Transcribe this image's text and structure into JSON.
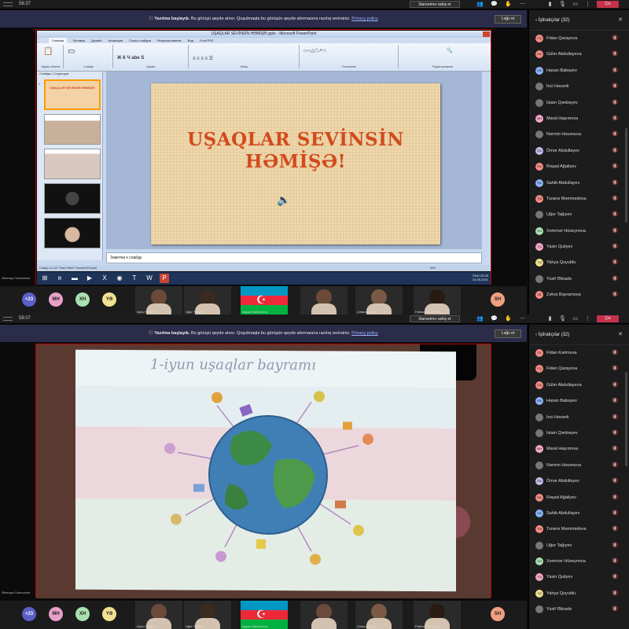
{
  "frames": [
    {
      "id": "top",
      "clock": "58:37",
      "share_label": "İdarəetmə xahiş et",
      "banner": {
        "bold": "Yazılma başlayıb.",
        "text": " Bu görüşü qeydə alınır. Qoşulmaqla bu görüşün qeydə alınmasına razılıq verirsiniz.",
        "link": "Privacy policy",
        "dismiss": "Ləğv et"
      },
      "leave": "Çıx",
      "presenter": "Ələmayə Səmədova"
    },
    {
      "id": "bottom",
      "clock": "58:07",
      "share_label": "İdarəetmə xahiş et",
      "banner": {
        "bold": "Yazılma başlayıb.",
        "text": " Bu görüşü qeydə alınır. Qoşulmaqla bu görüşün qeydə alınmasına razılıq verirsiniz.",
        "link": "Privacy policy",
        "dismiss": "Ləğv et"
      },
      "leave": "Çıx",
      "presenter": "Ələmayə Səmədova"
    }
  ],
  "ppt": {
    "title": "UŞAQLAR SEVİNSİN HƏMİŞƏ!.pptx - Microsoft PowerPoint",
    "tabs": [
      "Главная",
      "Вставка",
      "Дизайн",
      "Анимация",
      "Показ слайдов",
      "Рецензирование",
      "Вид",
      "Foxit PDF"
    ],
    "groups": [
      "Буфер обмена",
      "Слайды",
      "Шрифт",
      "Абзац",
      "Рисование",
      "Редактирование"
    ],
    "panel_tabs": "Слайды | Структура",
    "thumb_title": "UŞAQLAR SEVİNSİN HƏMİŞƏ!",
    "slide_title_line1": "UŞAQLAR SEVİNSİN",
    "slide_title_line2": "HƏMİŞƏ!",
    "notes": "Заметки к слайду",
    "status": "Слайд 1 из 33   \"Тема Office\"   Русский (Россия)",
    "zoom": "69%",
    "tray_time": "20:33",
    "tray_date": "31.05.2021",
    "tray_lang": "ENG"
  },
  "drawing": {
    "caption": "1-iyun uşaqlar bayramı"
  },
  "strip": {
    "count": "+23",
    "avatars": [
      {
        "initials": "MH",
        "color": "#e8a0c8"
      },
      {
        "initials": "XH",
        "color": "#a8e0b0"
      },
      {
        "initials": "YƏ",
        "color": "#f0e090"
      },
      {
        "initials": "SH",
        "color": "#f0a080"
      }
    ],
    "tiles": [
      "Aysu Həsənli",
      "Uğur Tağıyev",
      "Ayşən Şahbazova",
      "",
      "Çinarə Cəfərli",
      "Fatimə Səmədova"
    ]
  },
  "participants": {
    "title": "İştirakçılar",
    "count": "(32)",
    "top_list": [
      {
        "name": "Fidan Qarayeva",
        "color": "#f28b82",
        "ini": "FQ"
      },
      {
        "name": "Gülər Abdullayeva",
        "color": "#f28b82",
        "ini": "GA"
      },
      {
        "name": "Hasan Babayev",
        "color": "#8ab4f8",
        "ini": "HB"
      },
      {
        "name": "İnci Həsənli",
        "color": "#777777",
        "ini": ""
      },
      {
        "name": "İslam Qənbəyev",
        "color": "#777777",
        "ini": ""
      },
      {
        "name": "Maral Haşımova",
        "color": "#f4a6c8",
        "ini": "MH"
      },
      {
        "name": "Nərmin Həsənova",
        "color": "#777777",
        "ini": ""
      },
      {
        "name": "Ömər Abdullayev",
        "color": "#c7b8e8",
        "ini": "ÖA"
      },
      {
        "name": "Rəşad Ağaliyev",
        "color": "#f28b82",
        "ini": "RA"
      },
      {
        "name": "Sahib Abdullayev",
        "color": "#8ab4f8",
        "ini": "SA"
      },
      {
        "name": "Turanə Məmmədova",
        "color": "#f28b82",
        "ini": "TM"
      },
      {
        "name": "Uğur Tağıyev",
        "color": "#777777",
        "ini": ""
      },
      {
        "name": "Xəmmər Hüseynova",
        "color": "#a8e0b0",
        "ini": "XH"
      },
      {
        "name": "Yasin Quliyev",
        "color": "#f4a6c8",
        "ini": "YQ"
      },
      {
        "name": "Yahya Quyublu",
        "color": "#f0e090",
        "ini": "YQ"
      },
      {
        "name": "Yusif Əlizadə",
        "color": "#777777",
        "ini": ""
      },
      {
        "name": "Zəhra Bayramova",
        "color": "#f28b82",
        "ini": "ZB"
      }
    ],
    "bottom_list": [
      {
        "name": "Fidan Kərimova",
        "color": "#f28b82",
        "ini": "FK"
      },
      {
        "name": "Fidan Qarayeva",
        "color": "#f28b82",
        "ini": "FQ"
      },
      {
        "name": "Gülər Abdullayeva",
        "color": "#f28b82",
        "ini": "GA"
      },
      {
        "name": "Hasan Babayev",
        "color": "#8ab4f8",
        "ini": "HB"
      },
      {
        "name": "İnci Həsənli",
        "color": "#777777",
        "ini": ""
      },
      {
        "name": "İslam Qənbəyev",
        "color": "#777777",
        "ini": ""
      },
      {
        "name": "Maral Haşımova",
        "color": "#f4a6c8",
        "ini": "MH"
      },
      {
        "name": "Nərmin Həsənova",
        "color": "#777777",
        "ini": ""
      },
      {
        "name": "Ömər Abdullayev",
        "color": "#c7b8e8",
        "ini": "ÖA"
      },
      {
        "name": "Rəşad Ağaliyev",
        "color": "#f28b82",
        "ini": "RA"
      },
      {
        "name": "Sahib Abdullayev",
        "color": "#8ab4f8",
        "ini": "SA"
      },
      {
        "name": "Turanə Məmmədova",
        "color": "#f28b82",
        "ini": "TM"
      },
      {
        "name": "Uğur Tağıyev",
        "color": "#777777",
        "ini": ""
      },
      {
        "name": "Xəmmər Hüseynova",
        "color": "#a8e0b0",
        "ini": "XH"
      },
      {
        "name": "Yasin Quliyev",
        "color": "#f4a6c8",
        "ini": "YQ"
      },
      {
        "name": "Yahya Quyublu",
        "color": "#f0e090",
        "ini": "YQ"
      },
      {
        "name": "Yusif Əlizadə",
        "color": "#777777",
        "ini": ""
      }
    ]
  }
}
